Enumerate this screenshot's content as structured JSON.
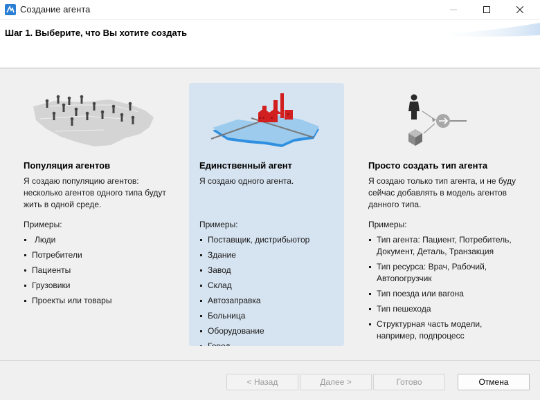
{
  "window": {
    "title": "Создание агента",
    "minimize_icon": "minimize-icon",
    "maximize_icon": "maximize-icon",
    "close_icon": "close-icon"
  },
  "header": {
    "step_title": "Шаг 1. Выберите, что Вы хотите создать"
  },
  "options": [
    {
      "title": "Популяция агентов",
      "description": "Я создаю популяцию агентов: несколько агентов одного типа будут жить в одной среде.",
      "examples_label": "Примеры:",
      "examples": [
        "Люди",
        "Потребители",
        "Пациенты",
        "Грузовики",
        "Проекты или товары"
      ],
      "illustration": "population-map-icon",
      "selected": false
    },
    {
      "title": "Единственный агент",
      "description": "Я создаю одного агента.",
      "examples_label": "Примеры:",
      "examples": [
        "Поставщик, дистрибьютор",
        "Здание",
        "Завод",
        "Склад",
        "Автозаправка",
        "Больница",
        "Оборудование",
        "Город"
      ],
      "illustration": "factory-map-icon",
      "selected": true
    },
    {
      "title": "Просто создать тип агента",
      "description": "Я создаю только тип агента, и не буду сейчас добавлять в модель агентов данного типа.",
      "examples_label": "Примеры:",
      "examples": [
        "Тип агента: Пациент, Потребитель, Документ, Деталь, Транзакция",
        "Тип ресурса: Врач, Рабочий, Автопогрузчик",
        "Тип поезда или вагона",
        "Тип пешехода",
        "Структурная часть модели, например, подпроцесс"
      ],
      "illustration": "agent-type-icon",
      "selected": false
    }
  ],
  "footer": {
    "back": "< Назад",
    "next": "Далее >",
    "finish": "Готово",
    "cancel": "Отмена"
  },
  "colors": {
    "selected_panel": "#d6e3f0",
    "content_bg": "#f0f0f0",
    "accent_red": "#d21f1f",
    "map_blue": "#8fc3ec"
  }
}
